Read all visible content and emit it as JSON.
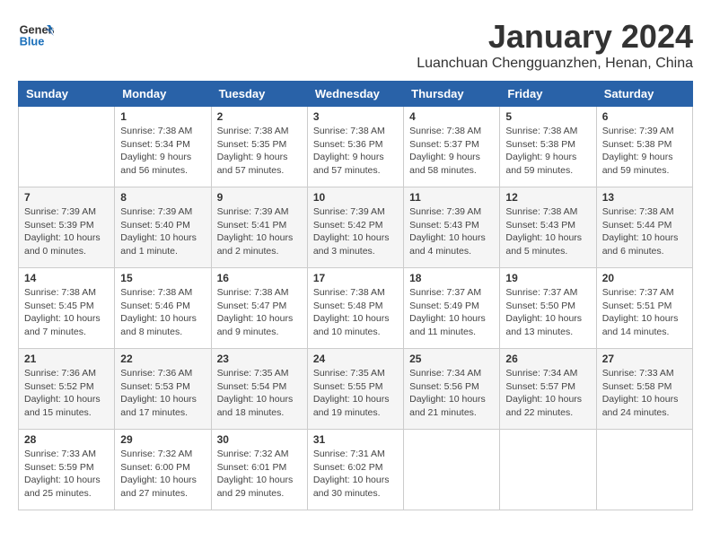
{
  "header": {
    "logo_line1": "General",
    "logo_line2": "Blue",
    "title": "January 2024",
    "location": "Luanchuan Chengguanzhen, Henan, China"
  },
  "weekdays": [
    "Sunday",
    "Monday",
    "Tuesday",
    "Wednesday",
    "Thursday",
    "Friday",
    "Saturday"
  ],
  "weeks": [
    [
      {
        "day": "",
        "info": ""
      },
      {
        "day": "1",
        "info": "Sunrise: 7:38 AM\nSunset: 5:34 PM\nDaylight: 9 hours\nand 56 minutes."
      },
      {
        "day": "2",
        "info": "Sunrise: 7:38 AM\nSunset: 5:35 PM\nDaylight: 9 hours\nand 57 minutes."
      },
      {
        "day": "3",
        "info": "Sunrise: 7:38 AM\nSunset: 5:36 PM\nDaylight: 9 hours\nand 57 minutes."
      },
      {
        "day": "4",
        "info": "Sunrise: 7:38 AM\nSunset: 5:37 PM\nDaylight: 9 hours\nand 58 minutes."
      },
      {
        "day": "5",
        "info": "Sunrise: 7:38 AM\nSunset: 5:38 PM\nDaylight: 9 hours\nand 59 minutes."
      },
      {
        "day": "6",
        "info": "Sunrise: 7:39 AM\nSunset: 5:38 PM\nDaylight: 9 hours\nand 59 minutes."
      }
    ],
    [
      {
        "day": "7",
        "info": "Sunrise: 7:39 AM\nSunset: 5:39 PM\nDaylight: 10 hours\nand 0 minutes."
      },
      {
        "day": "8",
        "info": "Sunrise: 7:39 AM\nSunset: 5:40 PM\nDaylight: 10 hours\nand 1 minute."
      },
      {
        "day": "9",
        "info": "Sunrise: 7:39 AM\nSunset: 5:41 PM\nDaylight: 10 hours\nand 2 minutes."
      },
      {
        "day": "10",
        "info": "Sunrise: 7:39 AM\nSunset: 5:42 PM\nDaylight: 10 hours\nand 3 minutes."
      },
      {
        "day": "11",
        "info": "Sunrise: 7:39 AM\nSunset: 5:43 PM\nDaylight: 10 hours\nand 4 minutes."
      },
      {
        "day": "12",
        "info": "Sunrise: 7:38 AM\nSunset: 5:43 PM\nDaylight: 10 hours\nand 5 minutes."
      },
      {
        "day": "13",
        "info": "Sunrise: 7:38 AM\nSunset: 5:44 PM\nDaylight: 10 hours\nand 6 minutes."
      }
    ],
    [
      {
        "day": "14",
        "info": "Sunrise: 7:38 AM\nSunset: 5:45 PM\nDaylight: 10 hours\nand 7 minutes."
      },
      {
        "day": "15",
        "info": "Sunrise: 7:38 AM\nSunset: 5:46 PM\nDaylight: 10 hours\nand 8 minutes."
      },
      {
        "day": "16",
        "info": "Sunrise: 7:38 AM\nSunset: 5:47 PM\nDaylight: 10 hours\nand 9 minutes."
      },
      {
        "day": "17",
        "info": "Sunrise: 7:38 AM\nSunset: 5:48 PM\nDaylight: 10 hours\nand 10 minutes."
      },
      {
        "day": "18",
        "info": "Sunrise: 7:37 AM\nSunset: 5:49 PM\nDaylight: 10 hours\nand 11 minutes."
      },
      {
        "day": "19",
        "info": "Sunrise: 7:37 AM\nSunset: 5:50 PM\nDaylight: 10 hours\nand 13 minutes."
      },
      {
        "day": "20",
        "info": "Sunrise: 7:37 AM\nSunset: 5:51 PM\nDaylight: 10 hours\nand 14 minutes."
      }
    ],
    [
      {
        "day": "21",
        "info": "Sunrise: 7:36 AM\nSunset: 5:52 PM\nDaylight: 10 hours\nand 15 minutes."
      },
      {
        "day": "22",
        "info": "Sunrise: 7:36 AM\nSunset: 5:53 PM\nDaylight: 10 hours\nand 17 minutes."
      },
      {
        "day": "23",
        "info": "Sunrise: 7:35 AM\nSunset: 5:54 PM\nDaylight: 10 hours\nand 18 minutes."
      },
      {
        "day": "24",
        "info": "Sunrise: 7:35 AM\nSunset: 5:55 PM\nDaylight: 10 hours\nand 19 minutes."
      },
      {
        "day": "25",
        "info": "Sunrise: 7:34 AM\nSunset: 5:56 PM\nDaylight: 10 hours\nand 21 minutes."
      },
      {
        "day": "26",
        "info": "Sunrise: 7:34 AM\nSunset: 5:57 PM\nDaylight: 10 hours\nand 22 minutes."
      },
      {
        "day": "27",
        "info": "Sunrise: 7:33 AM\nSunset: 5:58 PM\nDaylight: 10 hours\nand 24 minutes."
      }
    ],
    [
      {
        "day": "28",
        "info": "Sunrise: 7:33 AM\nSunset: 5:59 PM\nDaylight: 10 hours\nand 25 minutes."
      },
      {
        "day": "29",
        "info": "Sunrise: 7:32 AM\nSunset: 6:00 PM\nDaylight: 10 hours\nand 27 minutes."
      },
      {
        "day": "30",
        "info": "Sunrise: 7:32 AM\nSunset: 6:01 PM\nDaylight: 10 hours\nand 29 minutes."
      },
      {
        "day": "31",
        "info": "Sunrise: 7:31 AM\nSunset: 6:02 PM\nDaylight: 10 hours\nand 30 minutes."
      },
      {
        "day": "",
        "info": ""
      },
      {
        "day": "",
        "info": ""
      },
      {
        "day": "",
        "info": ""
      }
    ]
  ]
}
